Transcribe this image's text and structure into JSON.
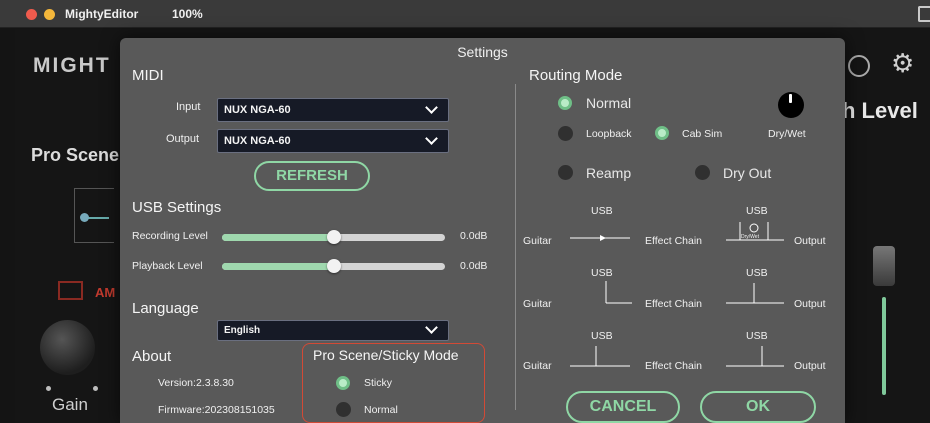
{
  "titlebar": {
    "app_name": "MightyEditor",
    "zoom": "100%"
  },
  "background": {
    "logo": "MIGHT",
    "pro_scene": "Pro Scene",
    "level_label": "h Level",
    "gain_label": "Gain",
    "amp_label": "AM"
  },
  "settings": {
    "title": "Settings",
    "midi": {
      "heading": "MIDI",
      "input_label": "Input",
      "input_value": "NUX NGA-60",
      "output_label": "Output",
      "output_value": "NUX NGA-60",
      "refresh_label": "REFRESH"
    },
    "usb": {
      "heading": "USB Settings",
      "recording_label": "Recording Level",
      "recording_value": "0.0dB",
      "recording_level": 0.5,
      "playback_label": "Playback Level",
      "playback_value": "0.0dB",
      "playback_level": 0.5
    },
    "language": {
      "heading": "Language",
      "value": "English"
    },
    "about": {
      "heading": "About",
      "version": "Version:2.3.8.30",
      "firmware": "Firmware:202308151035"
    },
    "sticky": {
      "heading": "Pro Scene/Sticky Mode",
      "option_sticky": "Sticky",
      "option_normal": "Normal",
      "selected": "Sticky"
    },
    "routing": {
      "heading": "Routing Mode",
      "normal": "Normal",
      "loopback": "Loopback",
      "cab_sim": "Cab Sim",
      "dry_wet": "Dry/Wet",
      "reamp": "Reamp",
      "dry_out": "Dry Out",
      "selected_mode": "Normal",
      "cab_sim_on": true
    },
    "diagram": {
      "usb": "USB",
      "guitar": "Guitar",
      "effect_chain": "Effect Chain",
      "output": "Output",
      "mini_label": "Dry/Wet"
    },
    "buttons": {
      "cancel": "CANCEL",
      "ok": "OK"
    }
  },
  "colors": {
    "accent_green": "#8fd7a5",
    "modal_bg": "#595959",
    "sticky_border": "#d24a36"
  }
}
